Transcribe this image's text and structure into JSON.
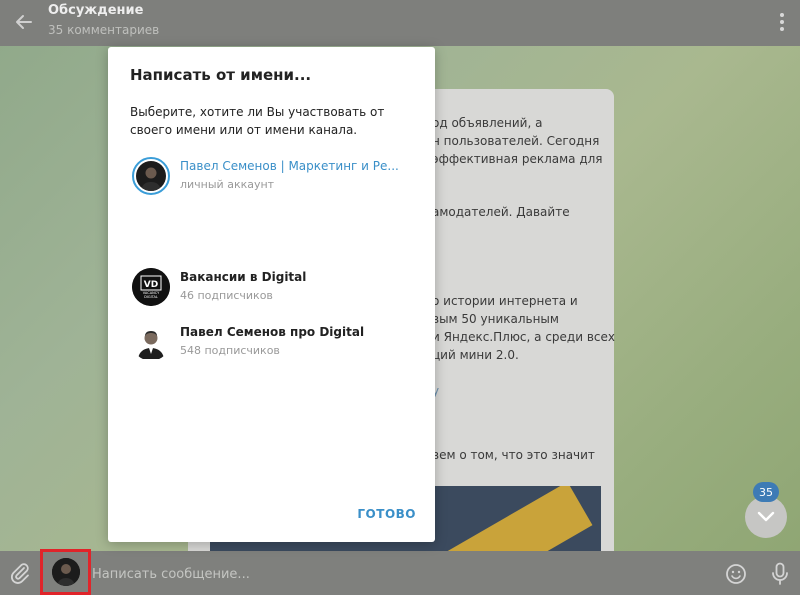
{
  "header": {
    "title": "Обсуждение",
    "subtitle": "35 комментариев"
  },
  "message": {
    "lines": [
      "од объявлений, а",
      "н пользователей. Сегодня",
      "эффективная реклама для",
      "амодателей. Давайте",
      "о истории интернета и",
      "вым 50 уникальным",
      "и Яндекс.Плюс, а среди всех",
      "ций мини 2.0.",
      "у",
      "вем о том, что это значит"
    ]
  },
  "scroll": {
    "badge_count": "35"
  },
  "input": {
    "placeholder": "Написать сообщение..."
  },
  "modal": {
    "title": "Написать от имени...",
    "description": "Выберите, хотите ли Вы участвовать от своего имени или от имени канала.",
    "accounts": [
      {
        "name": "Павел Семенов | Маркетинг и Ре...",
        "subtitle": "личный аккаунт",
        "selected": true
      },
      {
        "name": "Вакансии в Digital",
        "subtitle": "46 подписчиков",
        "selected": false,
        "logo_text": "VD",
        "logo_sub1": "VACANCY",
        "logo_sub2": "DIGITAL"
      },
      {
        "name": "Павел Семенов про Digital",
        "subtitle": "548 подписчиков",
        "selected": false
      }
    ],
    "done_label": "ГОТОВО"
  },
  "colors": {
    "accent": "#3a8fc8",
    "highlight": "#e0242a",
    "badge": "#3d7bb5"
  }
}
